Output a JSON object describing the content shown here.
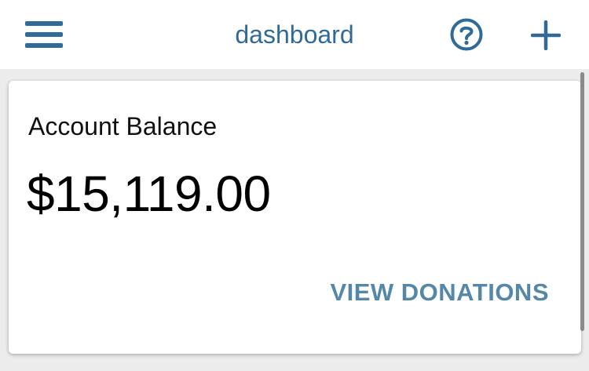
{
  "header": {
    "title": "dashboard",
    "menu_icon": "hamburger-menu-icon",
    "help_icon": "help-circle-icon",
    "add_icon": "plus-icon"
  },
  "account_card": {
    "label": "Account Balance",
    "amount": "$15,119.00",
    "link_label": "VIEW DONATIONS"
  },
  "colors": {
    "brand": "#2f6a99",
    "link": "#5588a8",
    "header_bg": "#ffffff",
    "page_bg": "#ececec"
  }
}
